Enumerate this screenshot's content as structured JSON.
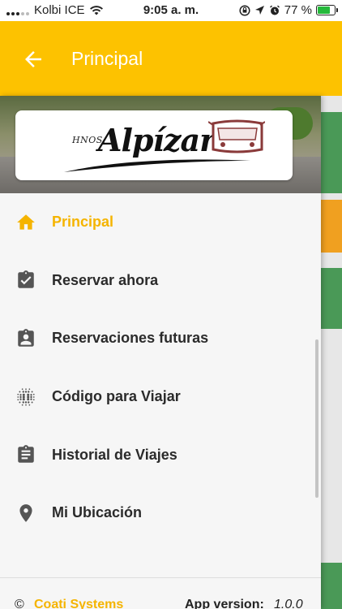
{
  "status_bar": {
    "carrier": "Kolbi ICE",
    "time": "9:05 a. m.",
    "battery_percent": "77 %",
    "battery_level": 0.77,
    "icons": [
      "signal-icon",
      "wifi-icon",
      "lock-rotation-icon",
      "location-icon",
      "alarm-icon",
      "battery-charging-icon"
    ]
  },
  "app_bar": {
    "title": "Principal",
    "back_icon": "arrow-back-icon",
    "color": "#fdc200"
  },
  "drawer": {
    "logo": {
      "small_text": "HNOS.",
      "name": "Alpízar"
    },
    "menu": [
      {
        "label": "Principal",
        "icon": "home-icon",
        "active": true
      },
      {
        "label": "Reservar ahora",
        "icon": "assignment-check-icon",
        "active": false
      },
      {
        "label": "Reservaciones futuras",
        "icon": "assignment-user-icon",
        "active": false
      },
      {
        "label": "Código para Viajar",
        "icon": "dot-grid-icon",
        "active": false
      },
      {
        "label": "Historial de Viajes",
        "icon": "assignment-list-icon",
        "active": false
      },
      {
        "label": "Mi Ubicación",
        "icon": "location-pin-icon",
        "active": false
      }
    ],
    "active_color": "#f5b400",
    "footer": {
      "copyright_symbol": "©",
      "company": "Coati Systems",
      "version_label": "App version:",
      "version_value": "1.0.0"
    }
  }
}
